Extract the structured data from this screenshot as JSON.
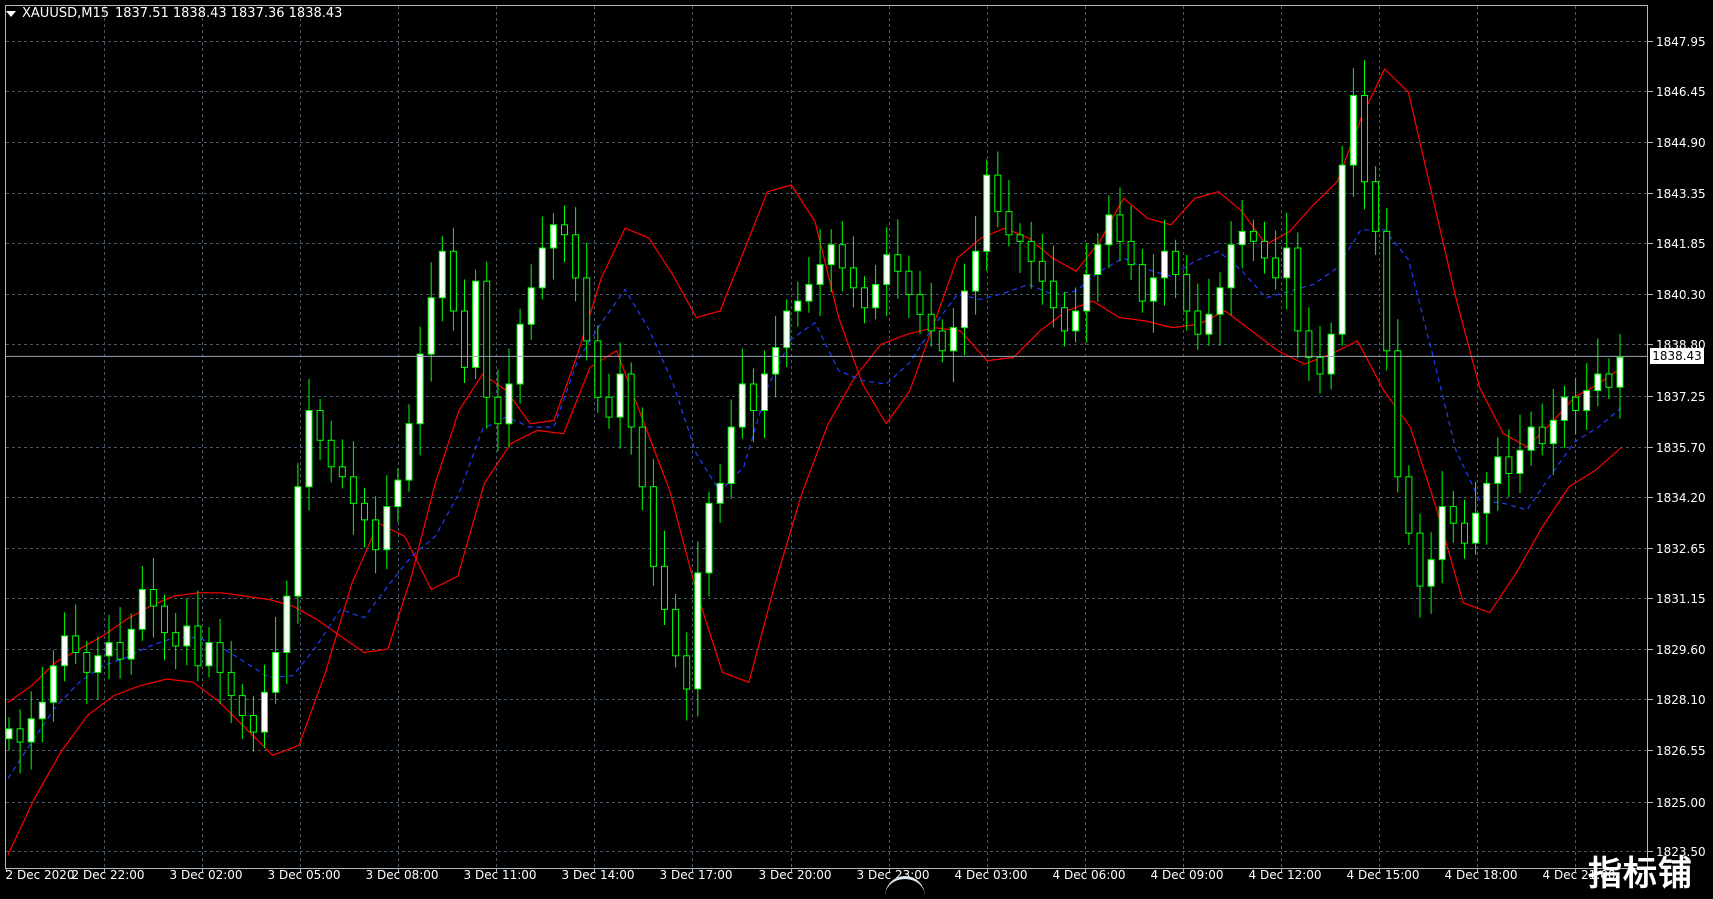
{
  "header": {
    "symbol": "XAUUSD,M15",
    "ohlc": "1837.51 1838.43 1837.36 1838.43"
  },
  "colors": {
    "background": "#000000",
    "grid": "#4a5866",
    "bull_candle": "#00ff00",
    "bull_body": "#ffffff",
    "bear_body": "#000000",
    "upper_band": "#ff0000",
    "lower_band": "#ff0000",
    "mid_band": "#1e3cff",
    "current_line": "#9aa7b4",
    "axis_text": "#ffffff"
  },
  "current_price": "1838.43",
  "watermark": "指标铺",
  "chart_data": {
    "type": "candlestick",
    "y_ticks": [
      "1847.95",
      "1846.45",
      "1844.90",
      "1843.35",
      "1841.85",
      "1840.30",
      "1838.80",
      "1837.25",
      "1835.70",
      "1834.20",
      "1832.65",
      "1831.15",
      "1829.60",
      "1828.10",
      "1826.55",
      "1825.00",
      "1823.50"
    ],
    "x_ticks": [
      "2 Dec 2020",
      "2 Dec 22:00",
      "3 Dec 02:00",
      "3 Dec 05:00",
      "3 Dec 08:00",
      "3 Dec 11:00",
      "3 Dec 14:00",
      "3 Dec 17:00",
      "3 Dec 20:00",
      "3 Dec 23:00",
      "4 Dec 03:00",
      "4 Dec 06:00",
      "4 Dec 09:00",
      "4 Dec 12:00",
      "4 Dec 15:00",
      "4 Dec 18:00",
      "4 Dec 21:00"
    ],
    "ylim": [
      1823.0,
      1849.0
    ],
    "grid": true,
    "closes": [
      1827.2,
      1826.8,
      1827.5,
      1828.0,
      1829.1,
      1830.0,
      1829.5,
      1828.9,
      1829.4,
      1829.8,
      1829.3,
      1830.2,
      1831.4,
      1830.9,
      1830.1,
      1829.7,
      1830.3,
      1829.1,
      1829.8,
      1828.9,
      1828.2,
      1827.6,
      1827.1,
      1828.3,
      1829.5,
      1831.2,
      1834.5,
      1836.8,
      1835.9,
      1835.1,
      1834.8,
      1834.0,
      1833.5,
      1832.6,
      1833.9,
      1834.7,
      1836.4,
      1838.5,
      1840.2,
      1841.6,
      1839.8,
      1838.1,
      1840.7,
      1837.2,
      1836.4,
      1837.6,
      1839.4,
      1840.5,
      1841.7,
      1842.4,
      1842.1,
      1840.8,
      1838.9,
      1837.2,
      1836.6,
      1837.9,
      1836.3,
      1834.5,
      1832.1,
      1830.8,
      1829.4,
      1828.4,
      1831.9,
      1834.0,
      1834.6,
      1836.3,
      1837.6,
      1836.8,
      1837.9,
      1838.7,
      1839.8,
      1840.1,
      1840.6,
      1841.2,
      1841.8,
      1841.1,
      1840.5,
      1839.9,
      1840.6,
      1841.5,
      1841.0,
      1840.3,
      1839.7,
      1839.2,
      1838.6,
      1839.3,
      1840.4,
      1841.6,
      1843.9,
      1842.8,
      1842.1,
      1841.9,
      1841.3,
      1840.7,
      1839.9,
      1839.2,
      1839.8,
      1840.9,
      1841.8,
      1842.7,
      1841.9,
      1841.2,
      1840.1,
      1840.8,
      1841.6,
      1840.9,
      1839.8,
      1839.1,
      1839.7,
      1840.5,
      1841.8,
      1842.2,
      1841.9,
      1841.4,
      1840.8,
      1841.7,
      1839.2,
      1838.4,
      1837.9,
      1839.1,
      1844.2,
      1846.3,
      1843.7,
      1842.2,
      1838.6,
      1834.8,
      1833.1,
      1831.5,
      1832.3,
      1833.9,
      1833.4,
      1832.8,
      1833.7,
      1834.6,
      1835.4,
      1834.9,
      1835.6,
      1836.3,
      1835.8,
      1836.5,
      1837.2,
      1836.8,
      1837.4,
      1837.9,
      1837.5,
      1838.4
    ]
  },
  "upper_band_values": [
    1828.0,
    1828.5,
    1829.2,
    1829.6,
    1830.0,
    1830.5,
    1830.9,
    1831.2,
    1831.3,
    1831.3,
    1831.2,
    1831.1,
    1830.9,
    1830.5,
    1830.0,
    1829.5,
    1829.6,
    1831.8,
    1834.6,
    1836.8,
    1837.9,
    1837.4,
    1836.4,
    1836.5,
    1838.5,
    1840.8,
    1842.3,
    1842.0,
    1840.9,
    1839.6,
    1839.8,
    1841.6,
    1843.4,
    1843.6,
    1842.5,
    1839.6,
    1837.6,
    1836.4,
    1837.4,
    1839.4,
    1841.4,
    1842.0,
    1842.3,
    1842.0,
    1841.4,
    1841.0,
    1841.9,
    1843.2,
    1842.6,
    1842.4,
    1843.2,
    1843.4,
    1842.8,
    1841.8,
    1842.2,
    1843.0,
    1843.7,
    1845.6,
    1847.1,
    1846.4,
    1843.3,
    1840.2,
    1837.5,
    1836.1,
    1835.7,
    1836.4,
    1837.2,
    1837.6,
    1838.1
  ],
  "lower_band_values": [
    1823.4,
    1825.1,
    1826.5,
    1827.6,
    1828.2,
    1828.5,
    1828.7,
    1828.6,
    1828.0,
    1827.2,
    1826.4,
    1826.7,
    1828.9,
    1831.6,
    1833.4,
    1833.0,
    1831.4,
    1831.8,
    1834.6,
    1835.8,
    1836.2,
    1836.1,
    1838.1,
    1838.6,
    1836.5,
    1834.4,
    1831.4,
    1828.9,
    1828.6,
    1831.6,
    1834.3,
    1836.4,
    1837.8,
    1838.8,
    1839.1,
    1839.3,
    1839.2,
    1838.3,
    1838.4,
    1839.2,
    1839.8,
    1840.1,
    1839.6,
    1839.5,
    1839.3,
    1839.4,
    1839.8,
    1839.2,
    1838.6,
    1838.2,
    1838.5,
    1838.9,
    1837.4,
    1836.3,
    1833.8,
    1831.0,
    1830.7,
    1831.9,
    1833.3,
    1834.5,
    1835.0,
    1835.7
  ]
}
